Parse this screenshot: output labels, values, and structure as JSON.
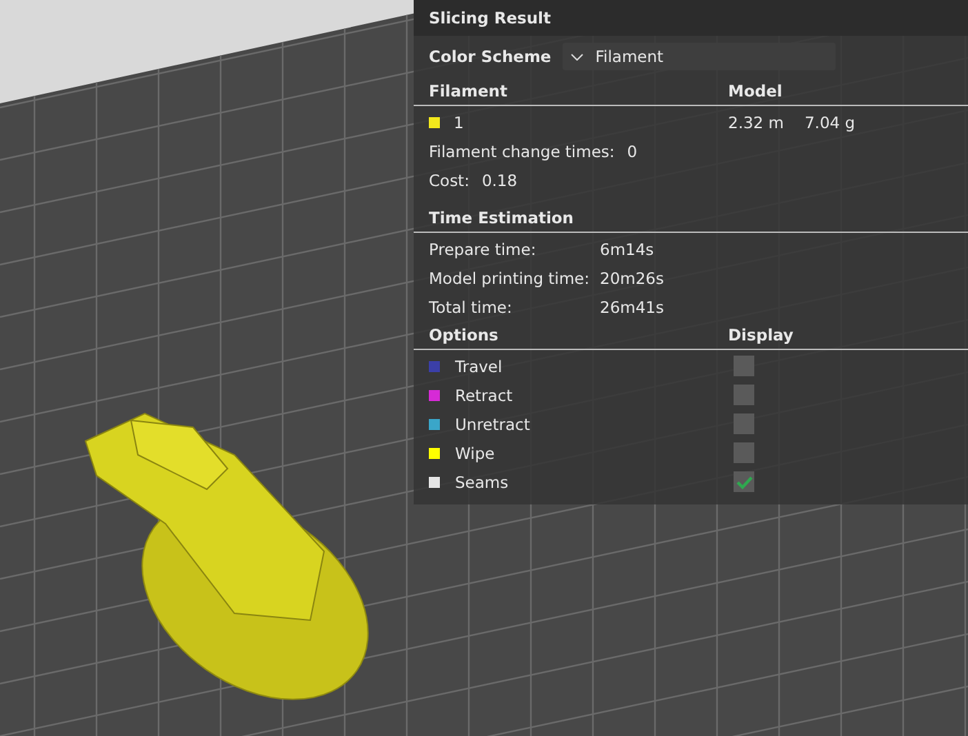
{
  "panel": {
    "title": "Slicing Result",
    "color_scheme": {
      "label": "Color Scheme",
      "value": "Filament"
    },
    "filament": {
      "columns": [
        "Filament",
        "Model"
      ],
      "rows": [
        {
          "name": "1",
          "color": "#f2e81c",
          "length": "2.32 m",
          "weight": "7.04 g"
        }
      ],
      "change_times": {
        "label": "Filament change times:",
        "value": "0"
      },
      "cost": {
        "label": "Cost:",
        "value": "0.18"
      }
    },
    "time_estimation": {
      "title": "Time Estimation",
      "rows": [
        {
          "label": "Prepare time:",
          "value": "6m14s"
        },
        {
          "label": "Model printing time:",
          "value": "20m26s"
        },
        {
          "label": "Total time:",
          "value": "26m41s"
        }
      ]
    },
    "options": {
      "columns": [
        "Options",
        "Display"
      ],
      "items": [
        {
          "label": "Travel",
          "color": "#3b3fa8",
          "checked": false
        },
        {
          "label": "Retract",
          "color": "#d62ad6",
          "checked": false
        },
        {
          "label": "Unretract",
          "color": "#3aa6c9",
          "checked": false
        },
        {
          "label": "Wipe",
          "color": "#ffff00",
          "checked": false
        },
        {
          "label": "Seams",
          "color": "#e6e6e6",
          "checked": true
        }
      ]
    }
  }
}
